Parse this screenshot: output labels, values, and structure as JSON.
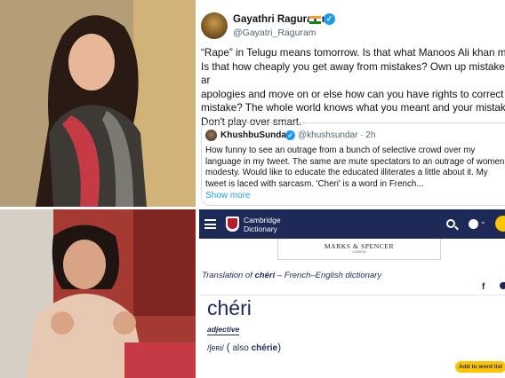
{
  "tweet": {
    "author_name": "Gayathri Raguramm",
    "author_handle": "@Gayatri_Raguram",
    "body": "“Rape” in Telugu means tomorrow. Is that what Manoos Ali khan mea\nIs that how cheaply you get away from mistakes? Own up mistakes ar\napologies and move on or else how can you have rights to correct oth\nmistake? The whole world knows what you meant and your mistake.\nDon't play over smart.",
    "verified_color": "#1d9bf0"
  },
  "quoted_tweet": {
    "author_name": "KhushbuSundar",
    "author_handle": "@khushsundar · 2h",
    "body": "How funny to see an outrage from a bunch of selective crowd over my\nlanguage in my tweet. The same are mute spectators to an outrage of women\nmodesty. Would like to educate the educated illiterates a little about it. My\ntweet is laced with sarcasm. 'Cheri' is a word in French...",
    "show_more": "Show more"
  },
  "dictionary": {
    "brand_line1": "Cambridge",
    "brand_line2": "Dictionary",
    "ad_brand": "MARKS & SPENCER",
    "ad_sub": "LONDON",
    "translation_prefix": "Translation of ",
    "translation_word": "chéri",
    "translation_suffix": " – French–English dictionary",
    "headword": "chéri",
    "part_of_speech": "adjective",
    "ipa": "/ʃeʀi/",
    "paren_open": "(",
    "also_label": "also",
    "variant": "chérie",
    "paren_close": ")",
    "add_to_word_list": "Add to word list",
    "facebook_glyph": "f",
    "header_color": "#1d2a57",
    "accent_color": "#fec400"
  },
  "icons": {
    "menu": "menu-icon",
    "search": "search-icon",
    "globe": "globe-icon",
    "user": "user-icon",
    "facebook": "facebook-icon",
    "twitter": "twitter-icon",
    "verified": "verified-badge-icon"
  }
}
